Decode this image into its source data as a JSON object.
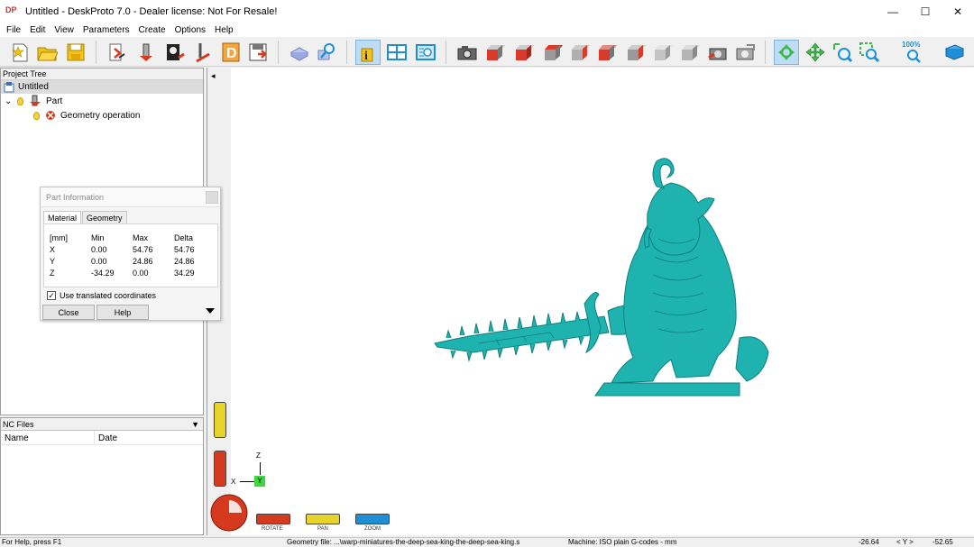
{
  "window": {
    "logo_text": "DP",
    "title": "Untitled - DeskProto 7.0 - Dealer license: Not For Resale!",
    "minimize": "—",
    "maximize": "☐",
    "close": "✕"
  },
  "menu": [
    "File",
    "Edit",
    "View",
    "Parameters",
    "Create",
    "Options",
    "Help"
  ],
  "toolbar": {
    "icons": [
      "new-file-icon",
      "open-folder-icon",
      "save-icon",
      "import-part-icon",
      "part-parameters-icon",
      "bitmap-icon",
      "vector-icon",
      "drawing-icon",
      "export-icon",
      "material-icon",
      "inspect-icon",
      "info-icon",
      "layout-icon",
      "preview-icon",
      "camera-icon",
      "view-front-icon",
      "view-red1-icon",
      "view-red2-icon",
      "view-red3-icon",
      "view-red4-icon",
      "view-red5-icon",
      "view-iso-icon",
      "view-gray-icon",
      "view-machine-icon",
      "view-grid-icon",
      "rotate-tool-icon",
      "pan-tool-icon",
      "zoom-tool-icon",
      "zoom-window-icon",
      "zoom-100-icon",
      "book-icon"
    ],
    "zoom_label": "100%",
    "info_glyph": "i"
  },
  "project_tree": {
    "header": "Project Tree",
    "root": "Untitled",
    "part": "Part",
    "geometry": "Geometry operation",
    "expand_glyph": "⌄"
  },
  "nc_files": {
    "header": "NC Files",
    "columns": [
      "Name",
      "Date"
    ],
    "dropdown": "▼"
  },
  "collapse_arrow": "◂",
  "part_info": {
    "title": "Part Information",
    "tabs": [
      "Material",
      "Geometry"
    ],
    "headers": [
      "[mm]",
      "Min",
      "Max",
      "Delta"
    ],
    "rows": [
      [
        "X",
        "0.00",
        "54.76",
        "54.76"
      ],
      [
        "Y",
        "0.00",
        "24.86",
        "24.86"
      ],
      [
        "Z",
        "-34.29",
        "0.00",
        "34.29"
      ]
    ],
    "checkbox_label": "Use translated coordinates",
    "checkbox_checked": true,
    "close_label": "Close",
    "help_label": "Help"
  },
  "axes": {
    "z": "Z",
    "x": "X",
    "y": "Y"
  },
  "view_controls": {
    "rotate": "ROTATE",
    "pan": "PAN",
    "zoom": "ZOOM"
  },
  "colors": {
    "model": "#1fb3b0",
    "model_dark": "#0f7f7d",
    "rotate": "#d63a1e",
    "pan": "#e8d32a",
    "zoom": "#1e8fd6",
    "y_axis": "#3fd63f"
  },
  "status": {
    "help": "For Help, press F1",
    "geometry_file": "Geometry file: ...\\warp-miniatures-the-deep-sea-king-the-deep-sea-king.s",
    "machine": "Machine: ISO plain G-codes - mm",
    "coord_x": "-26.64",
    "axis_label": "< Y >",
    "coord_y": "-52.65"
  }
}
